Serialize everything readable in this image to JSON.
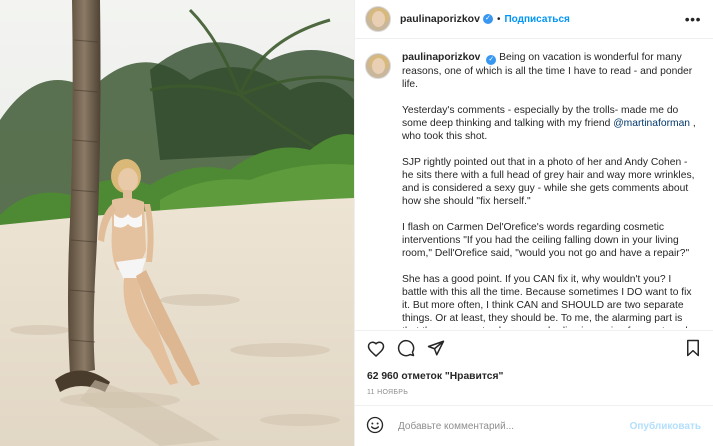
{
  "post": {
    "username": "paulinaporizkov",
    "follow_label": "Подписаться",
    "separator": "•",
    "photo_alt": "Woman in white bikini leaning on a palm tree on a sandy beach"
  },
  "caption": {
    "username": "paulinaporizkov",
    "intro": "Being on vacation is wonderful for many reasons, one of which is all the time I have to read - and ponder life.",
    "p2_before": "Yesterday's comments - especially by the trolls- made me do some deep thinking and talking with my friend ",
    "p2_mention": "@martinaforman",
    "p2_after": " , who took this shot.",
    "p3": "SJP rightly pointed out that in a photo of her and Andy Cohen - he sits there with a full head of grey hair and way more wrinkles, and is considered a sexy guy - while she gets comments about how she should \"fix herself.\"",
    "p4": "I flash on Carmen Del'Orefice's words regarding cosmetic interventions \"If you had the ceiling falling down in your living room,\" Dell'Orefice said, \"would you not go and have a repair?\"",
    "p5": "She has a good point. If you CAN fix it, why wouldn't you? I battle with this all the time. Because sometimes I DO want to fix it. But more often, I think CAN and SHOULD are two separate things. Or at least, they should be. To me, the alarming part is that the pressure to change our bodies is coming from external sources - like magazines, social media..."
  },
  "stats": {
    "likes_text": "62 960 отметок \"Нравится\"",
    "date": "11 НОЯБРЬ"
  },
  "comment": {
    "placeholder": "Добавьте комментарий...",
    "publish_label": "Опубликовать"
  },
  "icons": {
    "verified": "verified-badge-icon",
    "more": "more-options-icon",
    "like": "heart-icon",
    "comment": "comment-icon",
    "share": "share-icon",
    "save": "bookmark-icon",
    "emoji": "emoji-icon"
  },
  "colors": {
    "link_blue": "#0095f6",
    "mention": "#00376b",
    "verified": "#3897f0",
    "publish_disabled": "#b2dffc",
    "muted": "#8e8e8e",
    "border": "#efefef"
  }
}
